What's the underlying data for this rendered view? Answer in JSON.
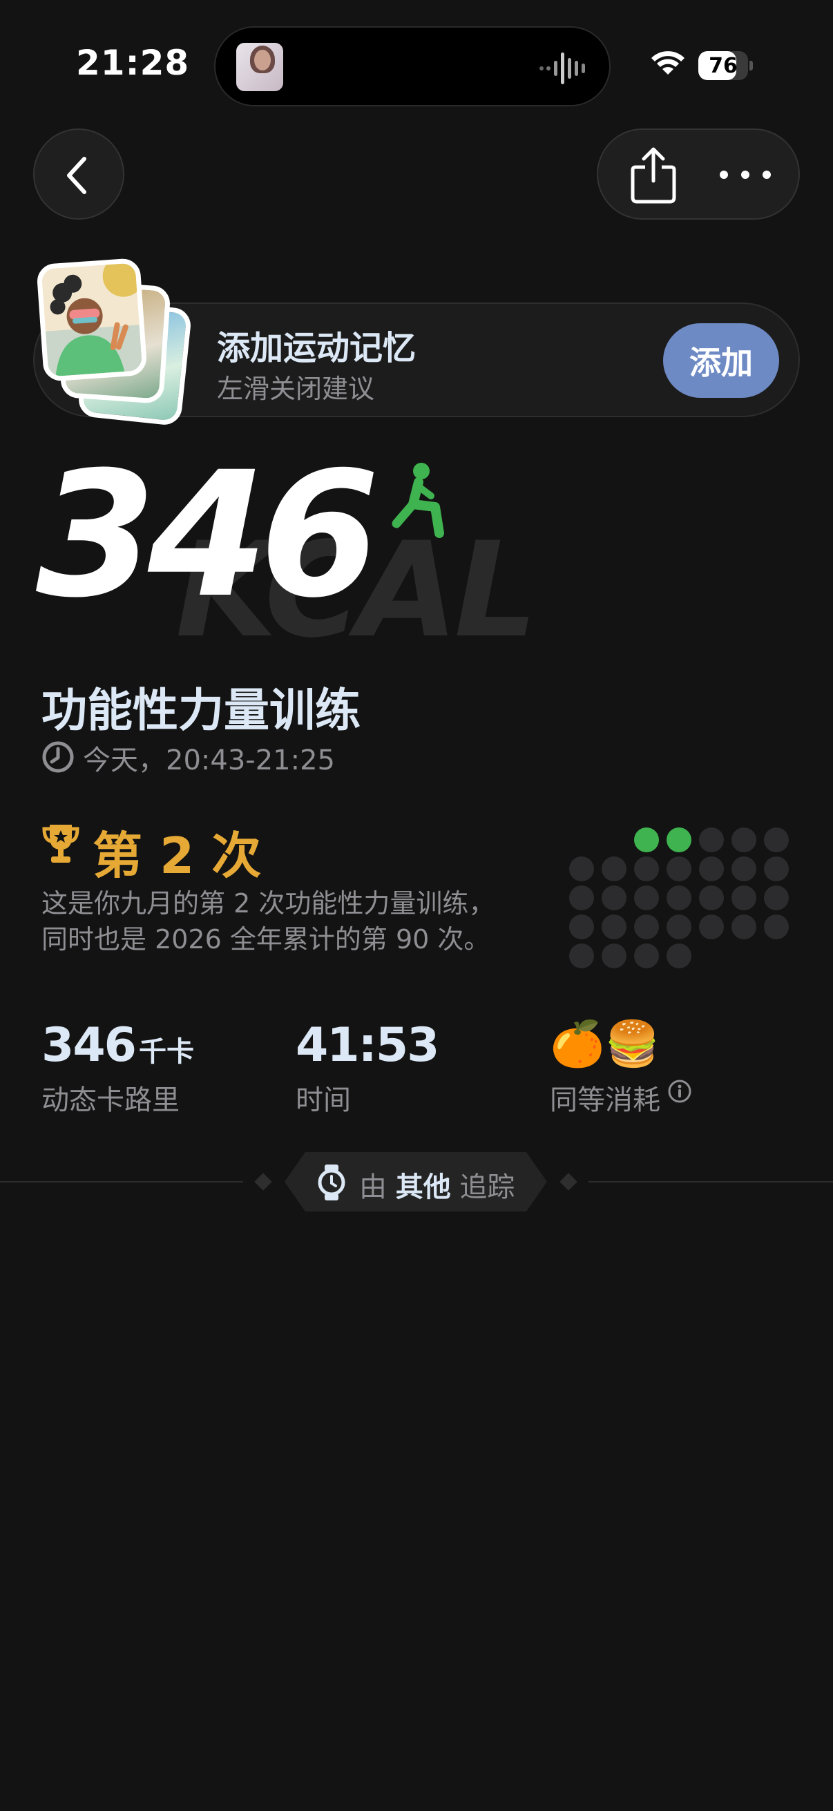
{
  "status_bar": {
    "time": "21:28",
    "battery": "76",
    "battery_level": 0.76,
    "icons": [
      "wifi-icon",
      "battery-icon",
      "waveform-icon"
    ]
  },
  "nav": {
    "icons": [
      "chevron-left-icon",
      "share-icon",
      "ellipsis-icon"
    ]
  },
  "memory_card": {
    "title": "添加运动记忆",
    "subtitle": "左滑关闭建议",
    "button": "添加"
  },
  "summary": {
    "calories": "346",
    "kcal_watermark": "KCAL",
    "accent_color": "#3fb34f"
  },
  "workout": {
    "title": "功能性力量训练",
    "time": "今天，20:43-21:25"
  },
  "achievement": {
    "rank": "第 2 次",
    "description_line1": "这是你九月的第 2 次功能性力量训练，",
    "description_line2": "同时也是 2026 全年累计的第 90 次。",
    "rank_color": "#e6a935",
    "dot_grid": {
      "total": 30,
      "highlighted": 2,
      "highlight_color": "#3fb34f",
      "base_color": "#2c2c2e"
    }
  },
  "stats": [
    {
      "value": "346",
      "unit": "千卡",
      "label": "动态卡路里"
    },
    {
      "value": "41:53",
      "unit": "",
      "label": "时间"
    },
    {
      "value": "🍊🍔",
      "unit": "",
      "label": "同等消耗"
    }
  ],
  "tracker": {
    "prefix": "由",
    "source": "其他",
    "suffix": "追踪"
  }
}
